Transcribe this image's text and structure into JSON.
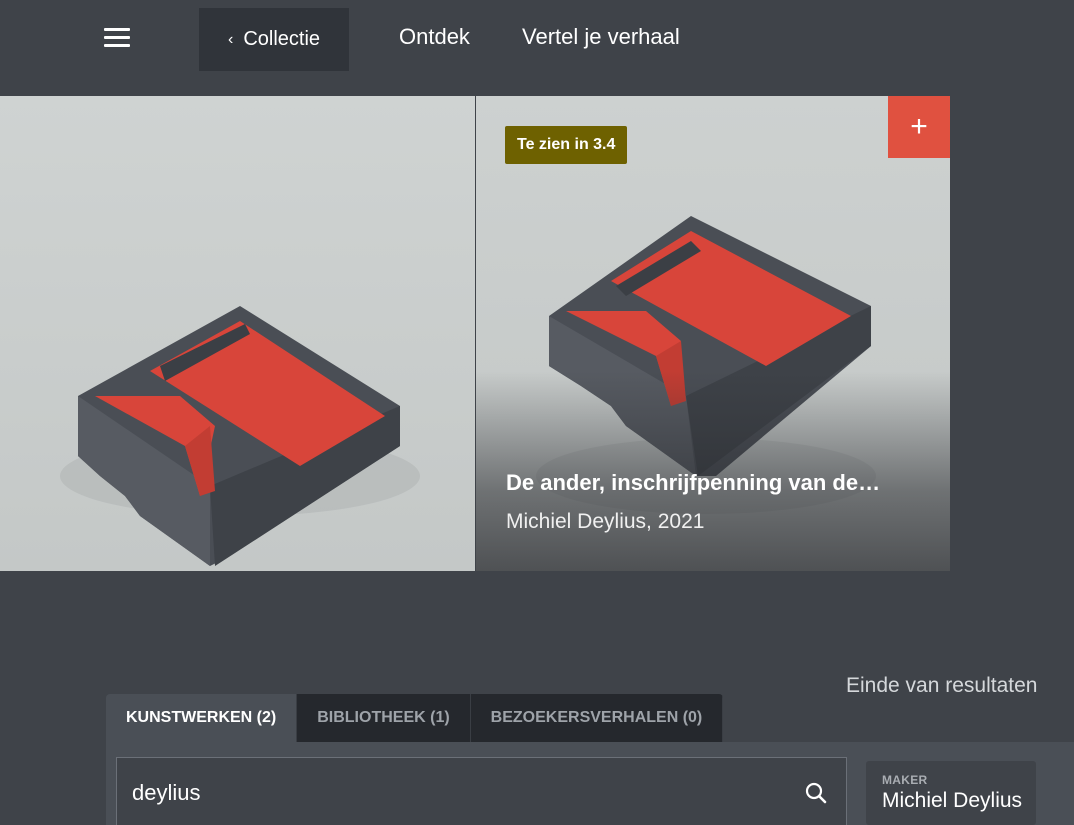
{
  "header": {
    "back_label": "Collectie",
    "nav": [
      "Ontdek",
      "Vertel je verhaal"
    ]
  },
  "results": {
    "cards": [
      {
        "image": "inscription-medal-grey-red"
      },
      {
        "image": "inscription-medal-grey-red",
        "badge": "Te zien in 3.4",
        "title": "De ander, inschrijfpenning van de…",
        "meta": "Michiel Deylius, 2021",
        "add_label": "+"
      }
    ],
    "end_text": "Einde van resultaten"
  },
  "tabs": [
    {
      "label": "KUNSTWERKEN (2)",
      "active": true
    },
    {
      "label": "BIBLIOTHEEK (1)",
      "active": false
    },
    {
      "label": "BEZOEKERSVERHALEN (0)",
      "active": false
    }
  ],
  "search": {
    "value": "deylius"
  },
  "filter": {
    "label": "MAKER",
    "value": "Michiel Deylius"
  },
  "colors": {
    "background": "#3f4349",
    "badge": "#6e6100",
    "add_button": "#e05140",
    "object_grey": "#4e5258",
    "object_red": "#d8453a"
  }
}
